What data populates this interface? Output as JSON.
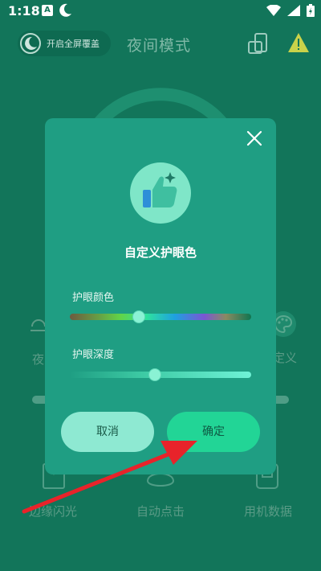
{
  "status": {
    "time": "1:18",
    "a_badge": "A"
  },
  "header": {
    "fullscreen_toggle": "开启全屏覆盖",
    "title": "夜间模式"
  },
  "background": {
    "left_label_partial": "夜",
    "right_label_partial": "定义",
    "bottom_items": [
      "边缘闪光",
      "自动点击",
      "用机数据"
    ]
  },
  "dialog": {
    "title": "自定义护眼色",
    "color_label": "护眼颜色",
    "color_value": 0.38,
    "depth_label": "护眼深度",
    "depth_value": 0.47,
    "cancel": "取消",
    "confirm": "确定"
  },
  "colors": {
    "background": "#12755a",
    "dialog": "#1f9e83",
    "confirm": "#22d596",
    "cancel": "#8ee9d2",
    "arrow": "#e8232a"
  },
  "icons": [
    "moon-icon",
    "phone-rotate-icon",
    "warning-icon",
    "close-icon",
    "thumbs-up-icon",
    "palette-icon",
    "wifi-icon",
    "signal-icon",
    "battery-icon"
  ]
}
